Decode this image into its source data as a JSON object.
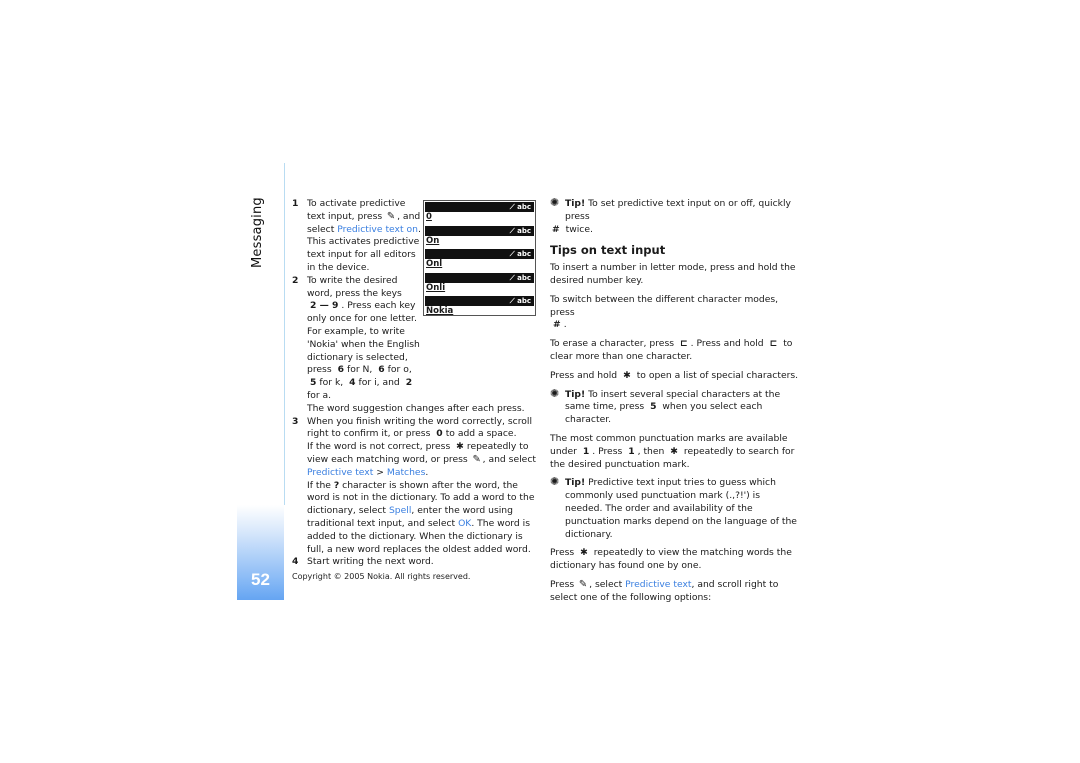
{
  "sidebar": {
    "section_title": "Messaging",
    "page_number": "52",
    "accent_color": "#65a5f2"
  },
  "footer": {
    "copyright": "Copyright © 2005 Nokia. All rights reserved."
  },
  "screens": {
    "indicator": "abc",
    "frames": [
      "0",
      "On",
      "Onl",
      "Onli",
      "Nokia"
    ]
  },
  "left_column": {
    "step1": {
      "num": "1",
      "a": "To activate predictive text input, press",
      "b": ", and select",
      "link": "Predictive text on",
      "c": ". This activates predictive text input for all editors in the device."
    },
    "step2": {
      "num": "2",
      "a": "To write the desired word, press the keys",
      "keys": "2 — 9",
      "b": ". Press each key only once for one letter. For example, to write 'Nokia' when the English dictionary is selected, press",
      "k1": "6",
      "t1": "for N,",
      "k2": "6",
      "t2": "for o,",
      "k3": "5",
      "t3": "for k,",
      "k4": "4",
      "t4": "for i, and",
      "k5": "2",
      "t5": "for a.",
      "note": "The word suggestion changes after each press."
    },
    "step3": {
      "num": "3",
      "a": "When you finish writing the word correctly, scroll right to confirm it, or press",
      "key0": "0",
      "b": "to add a space.",
      "c": "If the word is not correct, press",
      "star": "✱",
      "d": "repeatedly to view each matching word, or press",
      "e": ", and select",
      "link1": "Predictive text",
      "sep": " > ",
      "link2": "Matches",
      "f": ".",
      "g": "If the",
      "q": "?",
      "h": "character is shown after the word, the word is not in the dictionary. To add a word to the dictionary, select",
      "link3": "Spell",
      "i": ", enter the word using traditional text input, and select",
      "link4": "OK",
      "j": ". The word is added to the dictionary. When the dictionary is full, a new word replaces the oldest added word."
    },
    "step4": {
      "num": "4",
      "text": "Start writing the next word."
    }
  },
  "right_column": {
    "tip1": {
      "label": "Tip!",
      "a": "To set predictive text input on or off, quickly press",
      "key": "#",
      "b": "twice."
    },
    "heading": "Tips on text input",
    "p1": "To insert a number in letter mode, press and hold the desired number key.",
    "p2": {
      "a": "To switch between the different character modes, press",
      "key": "#",
      "b": "."
    },
    "p3": {
      "a": "To erase a character, press",
      "key": "C",
      "b": ". Press and hold",
      "c": "to clear more than one character."
    },
    "p4": {
      "a": "Press and hold",
      "key": "✱",
      "b": "to open a list of special characters."
    },
    "tip2": {
      "label": "Tip!",
      "a": "To insert several special characters at the same time, press",
      "key": "5",
      "b": "when you select each character."
    },
    "p5": {
      "a": "The most common punctuation marks are available under",
      "k1": "1",
      "b": ". Press",
      "k2": "1",
      "c": ", then",
      "k3": "✱",
      "d": "repeatedly to search for the desired punctuation mark."
    },
    "tip3": {
      "label": "Tip!",
      "a": "Predictive text input tries to guess which commonly used punctuation mark (.,?!') is needed. The order and availability of the punctuation marks depend on the language of the dictionary."
    },
    "p6": {
      "a": "Press",
      "key": "✱",
      "b": "repeatedly to view the matching words the dictionary has found one by one."
    },
    "p7": {
      "a": "Press",
      "b": ", select",
      "link": "Predictive text",
      "c": ", and scroll right to select one of the following options:"
    }
  }
}
